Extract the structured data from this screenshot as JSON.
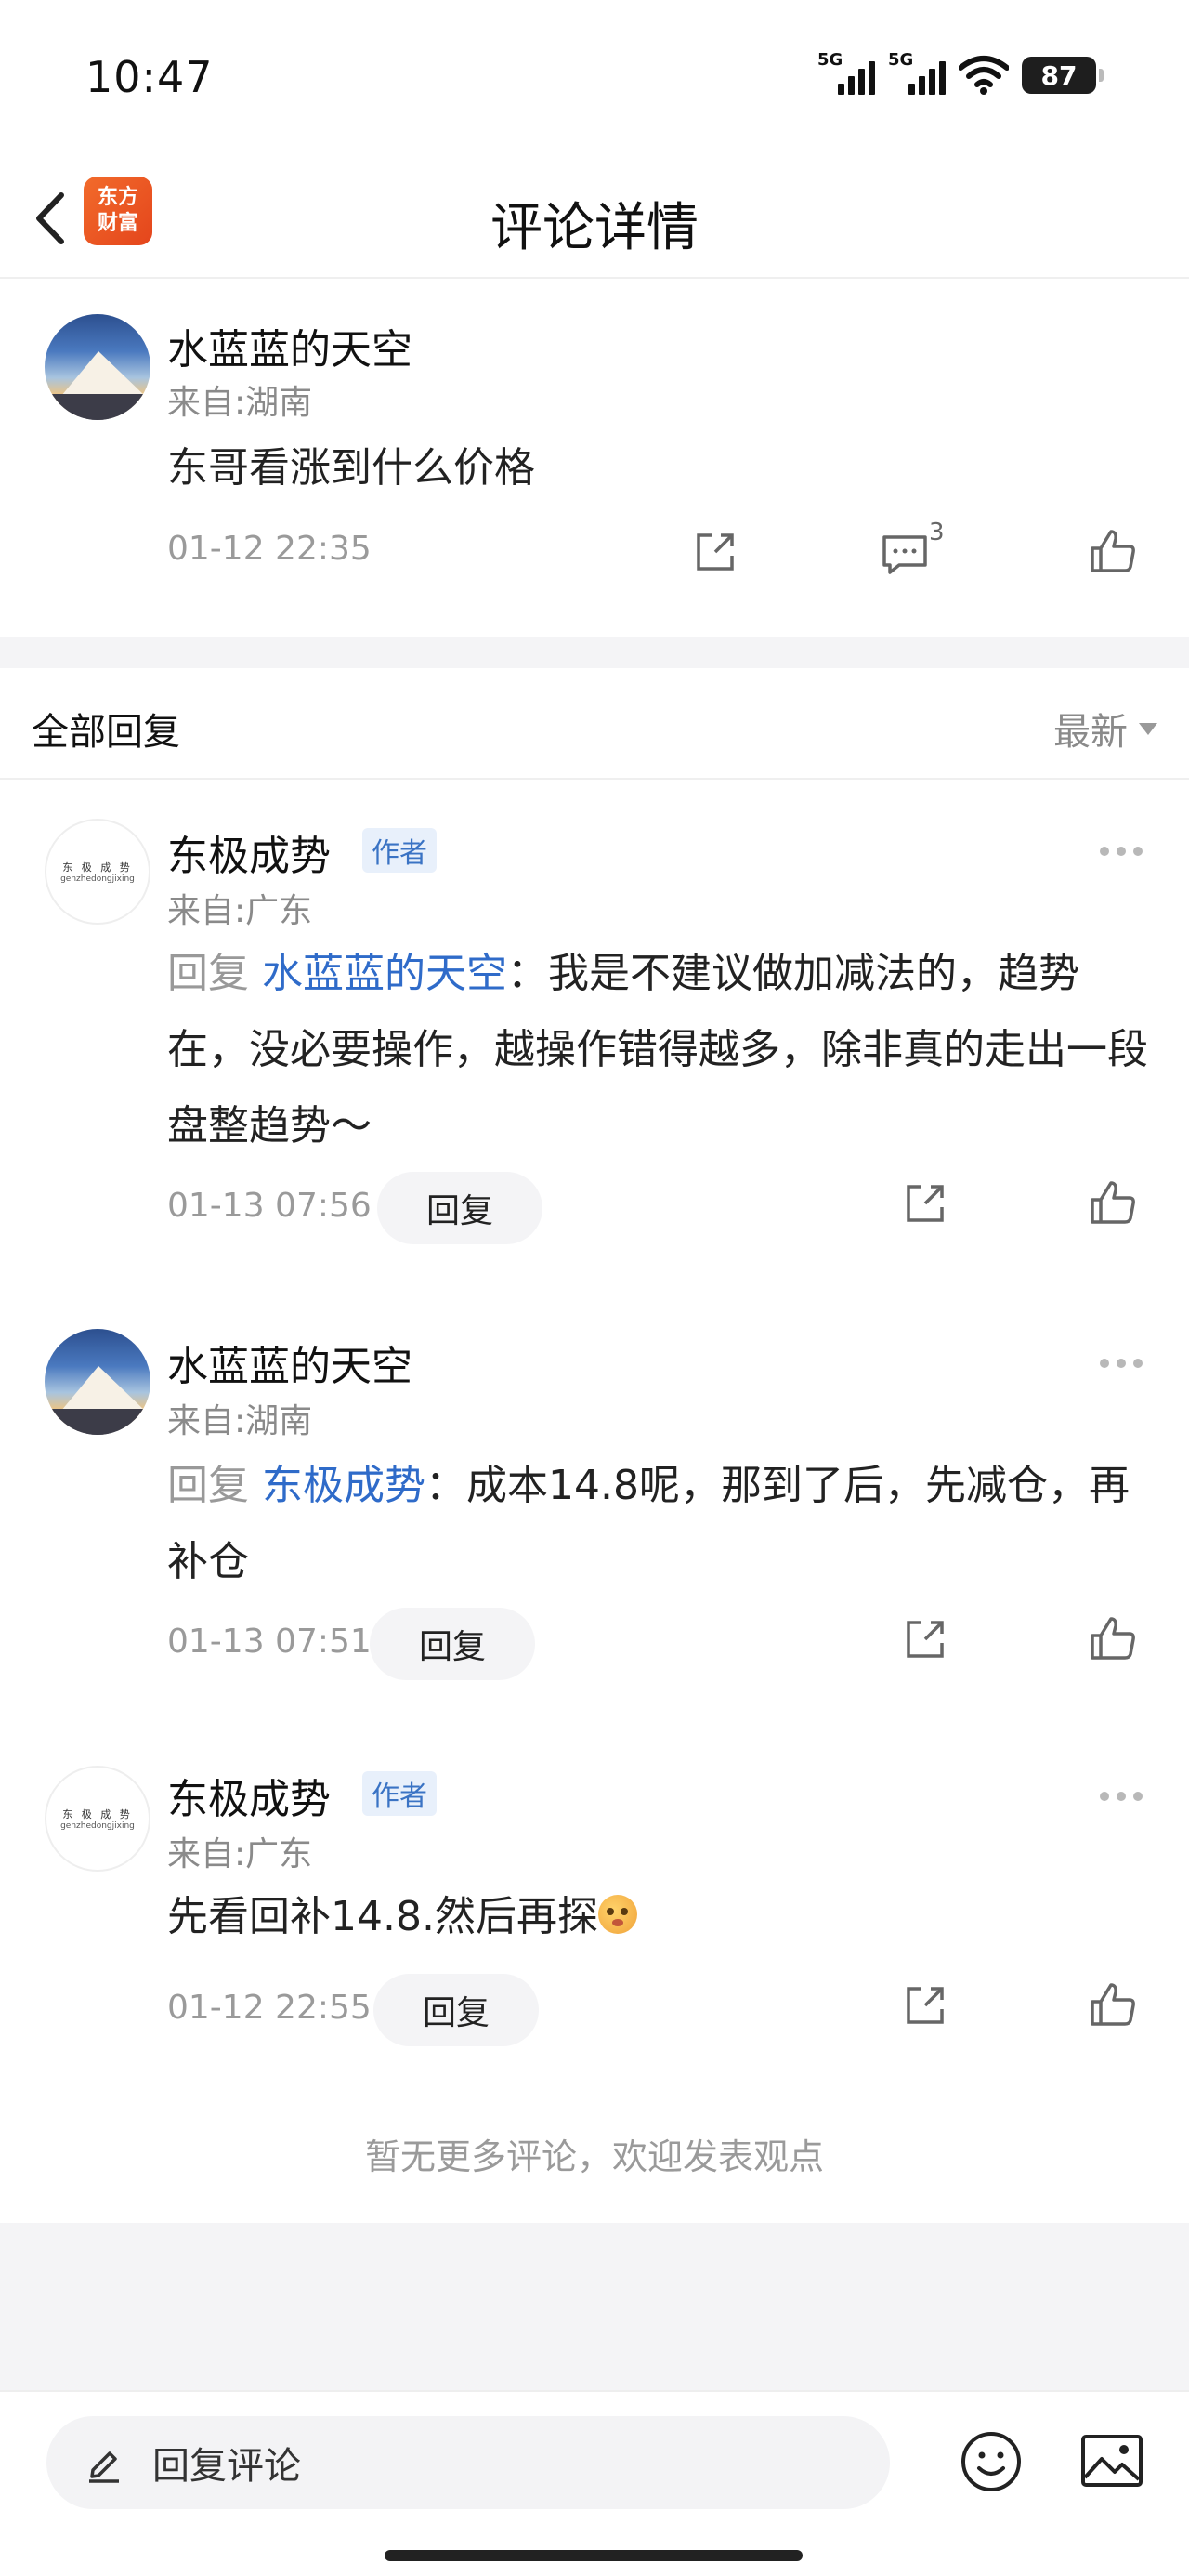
{
  "status_bar": {
    "time": "10:47",
    "network1": "5G",
    "network2": "5G",
    "battery": "87"
  },
  "header": {
    "title": "评论详情",
    "logo_line1": "东方",
    "logo_line2": "财富"
  },
  "main_comment": {
    "username": "水蓝蓝的天空",
    "location": "来自:湖南",
    "text": "东哥看涨到什么价格",
    "timestamp": "01-12 22:35",
    "reply_count": "3"
  },
  "replies_header": {
    "title": "全部回复",
    "sort": "最新"
  },
  "replies": [
    {
      "username": "东极成势",
      "badge": "作者",
      "location": "来自:广东",
      "prefix": "回复",
      "mention": "水蓝蓝的天空",
      "text": "：我是不建议做加减法的，趋势在，没必要操作，越操作错得越多，除非真的走出一段盘整趋势～",
      "timestamp": "01-13 07:56",
      "reply_label": "回复"
    },
    {
      "username": "水蓝蓝的天空",
      "badge": "",
      "location": "来自:湖南",
      "prefix": "回复",
      "mention": "东极成势",
      "text": "：成本14.8呢，那到了后，先减仓，再补仓",
      "timestamp": "01-13 07:51",
      "reply_label": "回复"
    },
    {
      "username": "东极成势",
      "badge": "作者",
      "location": "来自:广东",
      "text": "先看回补14.8.然后再探",
      "timestamp": "01-12 22:55",
      "reply_label": "回复"
    }
  ],
  "avatar_text": {
    "line1": "东 极 成 势",
    "line2": "genzhedongjixing"
  },
  "footer_note": "暂无更多评论，欢迎发表观点",
  "input": {
    "placeholder": "回复评论"
  },
  "colors": {
    "accent": "#2f6bc9",
    "brand": "#e4451c",
    "muted": "#9a9a9a"
  }
}
